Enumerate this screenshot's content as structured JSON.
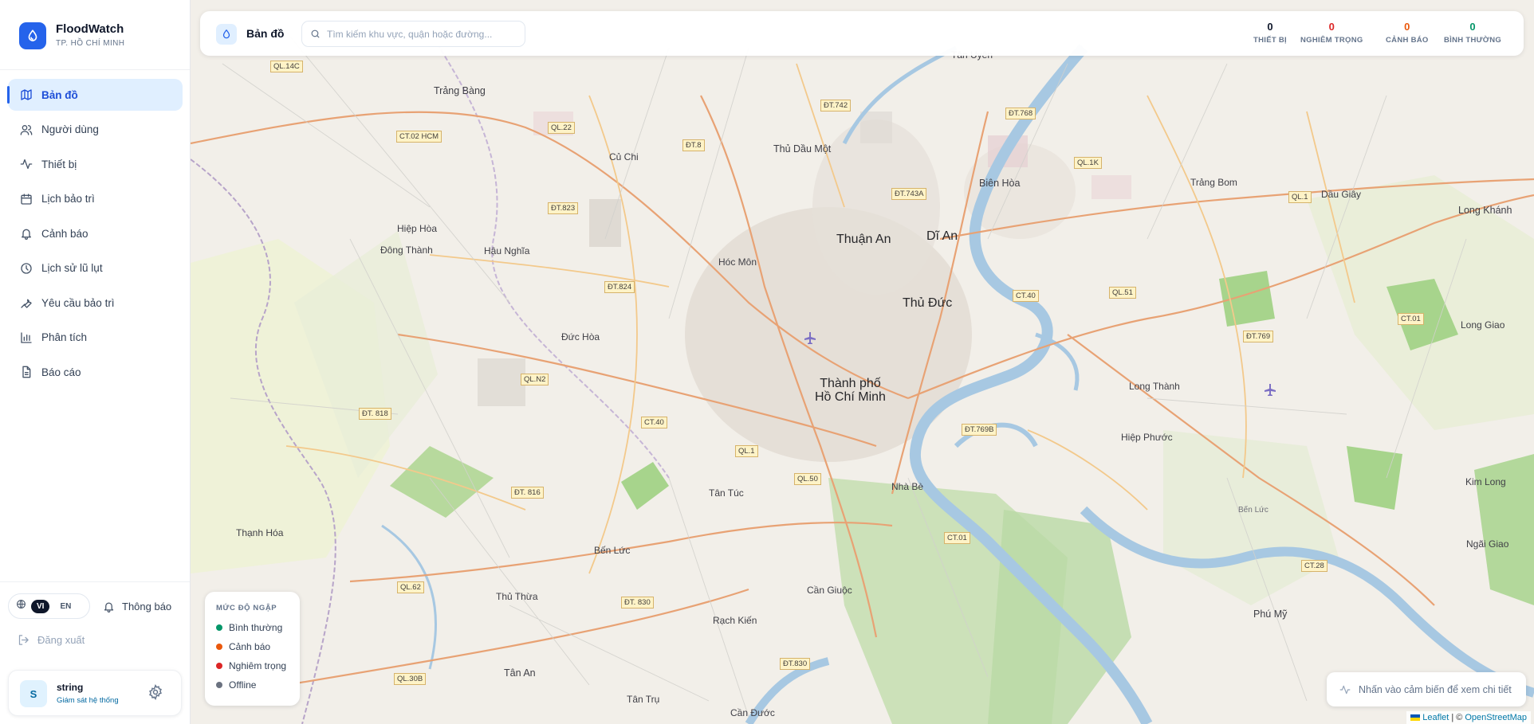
{
  "brand": {
    "name": "FloodWatch",
    "subtitle": "TP. HỒ CHÍ MINH"
  },
  "nav": [
    {
      "label": "Bản đồ",
      "icon": "map-icon",
      "active": true
    },
    {
      "label": "Người dùng",
      "icon": "users-icon"
    },
    {
      "label": "Thiết bị",
      "icon": "activity-icon"
    },
    {
      "label": "Lịch bảo trì",
      "icon": "calendar-icon"
    },
    {
      "label": "Cảnh báo",
      "icon": "bell-icon"
    },
    {
      "label": "Lịch sử lũ lụt",
      "icon": "history-icon"
    },
    {
      "label": "Yêu cầu bảo trì",
      "icon": "wrench-icon"
    },
    {
      "label": "Phân tích",
      "icon": "bar-chart-icon"
    },
    {
      "label": "Báo cáo",
      "icon": "file-icon"
    }
  ],
  "language": {
    "vi": "VI",
    "en": "EN",
    "active": "VI"
  },
  "notifications_label": "Thông báo",
  "logout_label": "Đăng xuất",
  "user": {
    "initial": "S",
    "name": "string",
    "role": "Giám sát hệ thống"
  },
  "topbar": {
    "title": "Bản đồ",
    "search_placeholder": "Tìm kiếm khu vực, quận hoặc đường...",
    "stats": [
      {
        "value": "0",
        "label": "THIẾT BỊ",
        "color": "#0f172a"
      },
      {
        "value": "0",
        "label": "NGHIÊM TRỌNG",
        "color": "#dc2626"
      },
      {
        "value": "0",
        "label": "CẢNH BÁO",
        "color": "#ea580c"
      },
      {
        "value": "0",
        "label": "BÌNH THƯỜNG",
        "color": "#059669"
      }
    ]
  },
  "legend": {
    "title": "MỨC ĐỘ NGẬP",
    "items": [
      {
        "label": "Bình thường",
        "color": "#059669"
      },
      {
        "label": "Cảnh báo",
        "color": "#ea580c"
      },
      {
        "label": "Nghiêm trọng",
        "color": "#dc2626"
      },
      {
        "label": "Offline",
        "color": "#6b7280"
      }
    ]
  },
  "hint": "Nhấn vào cảm biến để xem chi tiết",
  "attribution": {
    "leaflet": "Leaflet",
    "separator": "| ©",
    "osm": "OpenStreetMap"
  },
  "map_labels": {
    "hcmc_1": "Thành phố",
    "hcmc_2": "Hồ Chí Minh",
    "thu_duc": "Thủ Đức",
    "thuan_an": "Thuận An",
    "di_an": "Dĩ An",
    "thu_dau_mot": "Thủ Dầu Một",
    "bien_hoa": "Biên Hòa",
    "trang_bang": "Trảng Bàng",
    "cu_chi": "Củ Chi",
    "hoc_mon": "Hóc Môn",
    "hiep_hoa": "Hiệp Hòa",
    "dong_thanh": "Đông Thành",
    "hau_nghia": "Hậu Nghĩa",
    "duc_hoa": "Đức Hòa",
    "ben_luc": "Bến Lức",
    "tan_tuc": "Tân Túc",
    "nha_be": "Nhà Bè",
    "can_giuoc": "Cần Giuộc",
    "thu_thua": "Thủ Thừa",
    "rach_kien": "Rạch Kiến",
    "tan_an": "Tân An",
    "thanh_hoa": "Thạnh Hóa",
    "long_thanh": "Long Thành",
    "hiep_phuoc": "Hiệp Phước",
    "trang_bom": "Trảng Bom",
    "dau_giay": "Dầu Giây",
    "long_khanh": "Long Khánh",
    "long_giao": "Long Giao",
    "kim_long": "Kim Long",
    "ngai_giao": "Ngãi Giao",
    "phu_my": "Phú Mỹ",
    "ben_luc_2": "Bến Lức",
    "tan_tru": "Tân Trụ",
    "can_duoc": "Cần Đước",
    "tan_uyen": "Tân Uyên"
  },
  "road_labels": [
    "QL.22",
    "CT.02 HCM",
    "ĐT.8",
    "ĐT.742",
    "ĐT.768",
    "QL.1K",
    "ĐT.743A",
    "ĐT.823",
    "ĐT.824",
    "QL.N2",
    "CT.40",
    "ĐT. 818",
    "QL.1",
    "QL.50",
    "ĐT. 816",
    "QL.62",
    "ĐT. 830",
    "QL.30B",
    "ĐT.830",
    "CT.01",
    "ĐT.769B",
    "CT.40",
    "QL.51",
    "ĐT.769",
    "CT.01",
    "QL.1",
    "CT.28",
    "QL.14C"
  ]
}
